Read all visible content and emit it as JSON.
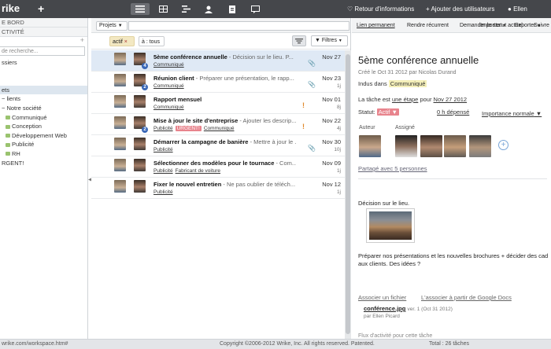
{
  "topbar": {
    "logo": "rike",
    "plus": "+",
    "links": {
      "news": "Retour d'informations",
      "add_users": "Ajouter des utilisateurs",
      "user": "Ellen"
    }
  },
  "sidebar": {
    "section1": "E BORD",
    "section2": "CTIVITÉ",
    "search_placeholder": "de recherche...",
    "items": [
      {
        "label": "ssiers"
      },
      {
        "label": ""
      },
      {
        "label": ""
      },
      {
        "label": "ets"
      },
      {
        "label": "lients"
      },
      {
        "label": "Notre société"
      },
      {
        "label": "Communiqué"
      },
      {
        "label": "Conception"
      },
      {
        "label": "Développement Web"
      },
      {
        "label": "Publicité"
      },
      {
        "label": "RH"
      },
      {
        "label": "RGENT!"
      }
    ]
  },
  "middle": {
    "projects_btn": "Projets",
    "chip_actif": "actif",
    "chip_tous": "à : tous",
    "filters_btn": "Filtres",
    "tasks": [
      {
        "title": "5ème conférence annuelle",
        "desc": " - Décision sur le lieu. P...",
        "tags": [
          "Communiqué"
        ],
        "date": "Nov 27",
        "dur": "",
        "badge": "4",
        "clip": true,
        "excl": false,
        "urgent": false
      },
      {
        "title": "Réunion client",
        "desc": " - Préparer une présentation, le rapp...",
        "tags": [
          "Communiqué"
        ],
        "date": "Nov 23",
        "dur": "1j",
        "badge": "2",
        "clip": true,
        "excl": false,
        "urgent": false
      },
      {
        "title": "Rapport mensuel",
        "desc": "",
        "tags": [
          "Communiqué"
        ],
        "date": "Nov 01",
        "dur": "8j",
        "badge": "",
        "clip": false,
        "excl": true,
        "urgent": false
      },
      {
        "title": "Mise à jour le site d'entreprise",
        "desc": " - Ajouter les descrip...",
        "tags": [
          "Publicité",
          "URGENT!",
          "Communiqué"
        ],
        "date": "Nov 22",
        "dur": "4j",
        "badge": "2",
        "clip": false,
        "excl": true,
        "urgent": true
      },
      {
        "title": "Démarrer la campagne de banière",
        "desc": " - Mettre à jour le ...",
        "tags": [
          "Publicité"
        ],
        "date": "Nov 30",
        "dur": "10j",
        "badge": "",
        "clip": true,
        "excl": false,
        "urgent": false
      },
      {
        "title": "Sélectionner des modèles pour le tournace",
        "desc": " - Com...",
        "tags": [
          "Publicité",
          "Fabricant de voiture"
        ],
        "date": "Nov 09",
        "dur": "1j",
        "badge": "",
        "clip": false,
        "excl": false,
        "urgent": false
      },
      {
        "title": "Fixer le nouvel entretien",
        "desc": " - Ne pas oublier de téléch...",
        "tags": [
          "Publicité"
        ],
        "date": "Nov 12",
        "dur": "1j",
        "badge": "",
        "clip": false,
        "excl": false,
        "urgent": false
      }
    ]
  },
  "detail": {
    "toolbar": {
      "permalink": "Lien permanent",
      "recurrent": "Rendre récurrent",
      "ask_status": "Demander le statut actuel",
      "follow": "Suivre",
      "import": "Importer",
      "export": "Exporter"
    },
    "title": "5ème conférence annuelle",
    "created": "Créé le Oct 31 2012 par Nicolas Durand",
    "included_label": "Indus dans",
    "included_value": "Communiqué",
    "step_text": "La tâche est",
    "step_link": "une étape",
    "step_text2": "pour",
    "step_date": "Nov 27 2012",
    "status_label": "Statut:",
    "status_value": "Actif",
    "hours": "0 h dépensé",
    "importance": "Importance normale",
    "author_label": "Auteur",
    "assignee_label": "Assigné",
    "shared": "Partagé avec 5 personnes",
    "desc_line1": "Décision sur le lieu.",
    "desc_line2": "Préparer nos présentations et les nouvelles brochures + décider des cad aux clients. Des idées ?",
    "assoc_file": "Associer un fichier",
    "assoc_gdocs": "L'associer à partir de Google Docs",
    "file_name": "conférence.jpg",
    "file_ver": "ver. 1 (Oct 31 2012)",
    "file_by": "par Ellen Picard",
    "flux": "Flux d'activité pour cette tâche"
  },
  "statusbar": {
    "url": "wrike.com/workspace.htm#",
    "copyright": "Copyright ©2006-2012 Wrike, Inc. All rights reserved. Patented.",
    "total": "Total : 26 tâches"
  },
  "colors": {
    "topbar": "#45474b",
    "urgent": "#e8848d",
    "selected_row": "#dfe9f5",
    "badge": "#3a68b8"
  }
}
